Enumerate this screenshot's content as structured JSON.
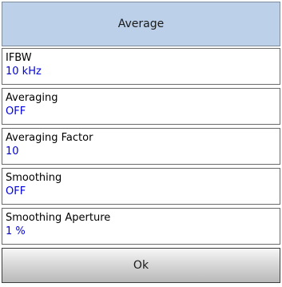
{
  "header": {
    "title": "Average"
  },
  "items": [
    {
      "label": "IFBW",
      "value": "10 kHz"
    },
    {
      "label": "Averaging",
      "value": "OFF"
    },
    {
      "label": "Averaging Factor",
      "value": "10"
    },
    {
      "label": "Smoothing",
      "value": "OFF"
    },
    {
      "label": "Smoothing Aperture",
      "value": "1 %"
    }
  ],
  "ok_button": {
    "label": "Ok"
  },
  "colors": {
    "header_background": "#bcd0ea",
    "value_text": "#0000dd"
  }
}
